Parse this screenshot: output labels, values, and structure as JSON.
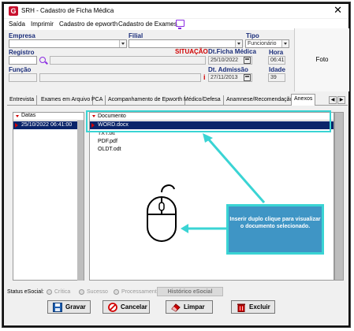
{
  "window": {
    "title": "SRH - Cadastro de Ficha Médica",
    "app_icon": "G",
    "close": "✕"
  },
  "menu": {
    "items": [
      "Saída",
      "Imprimir",
      "Cadastro de epworth",
      "Cadastro de Exames"
    ]
  },
  "form": {
    "empresa_label": "Empresa",
    "filial_label": "Filial",
    "tipo_label": "Tipo",
    "tipo_value": "Funcionário",
    "registro_label": "Registro",
    "situacao_label": "SITUAÇÃO",
    "dt_ficha_label": "Dt.Ficha Médica",
    "dt_ficha_value": "25/10/2022",
    "hora_label": "Hora",
    "hora_value": "06:41",
    "funcao_label": "Função",
    "dt_admissao_label": "Dt. Admissão",
    "dt_admissao_value": "27/11/2013",
    "idade_label": "Idade",
    "idade_value": "39",
    "info_mark": "i",
    "foto_label": "Foto"
  },
  "tabs": {
    "items": [
      "Entrevista",
      "Exames em Arquivo",
      "PCA",
      "Acompanhamento de Epworth",
      "Médico/Defesa",
      "Anamnese/Recomendação",
      "Anexos"
    ],
    "active": "Anexos"
  },
  "dates_list": {
    "header": "Datas",
    "rows": [
      "25/10/2022 06:41:00"
    ]
  },
  "documents": {
    "header": "Documento",
    "rows": [
      "WORD.docx",
      "TXT.txt",
      "PDF.pdf",
      "OLDT.odt"
    ],
    "selected": "WORD.docx"
  },
  "callout": {
    "text": "Inserir duplo clique para visualizar o documento selecionado."
  },
  "status_bar": {
    "label": "Status eSocial:",
    "options": [
      "Crítica",
      "Sucesso",
      "Processamento"
    ],
    "history_button": "Histórico eSocial"
  },
  "actions": {
    "save": "Gravar",
    "cancel": "Cancelar",
    "clear": "Limpar",
    "delete": "Excluir"
  },
  "colors": {
    "accent": "#3ad4d4",
    "callout_bg": "#3f95c5",
    "selection": "#0a246a",
    "label": "#1a2d7a",
    "alert": "#d10000"
  }
}
